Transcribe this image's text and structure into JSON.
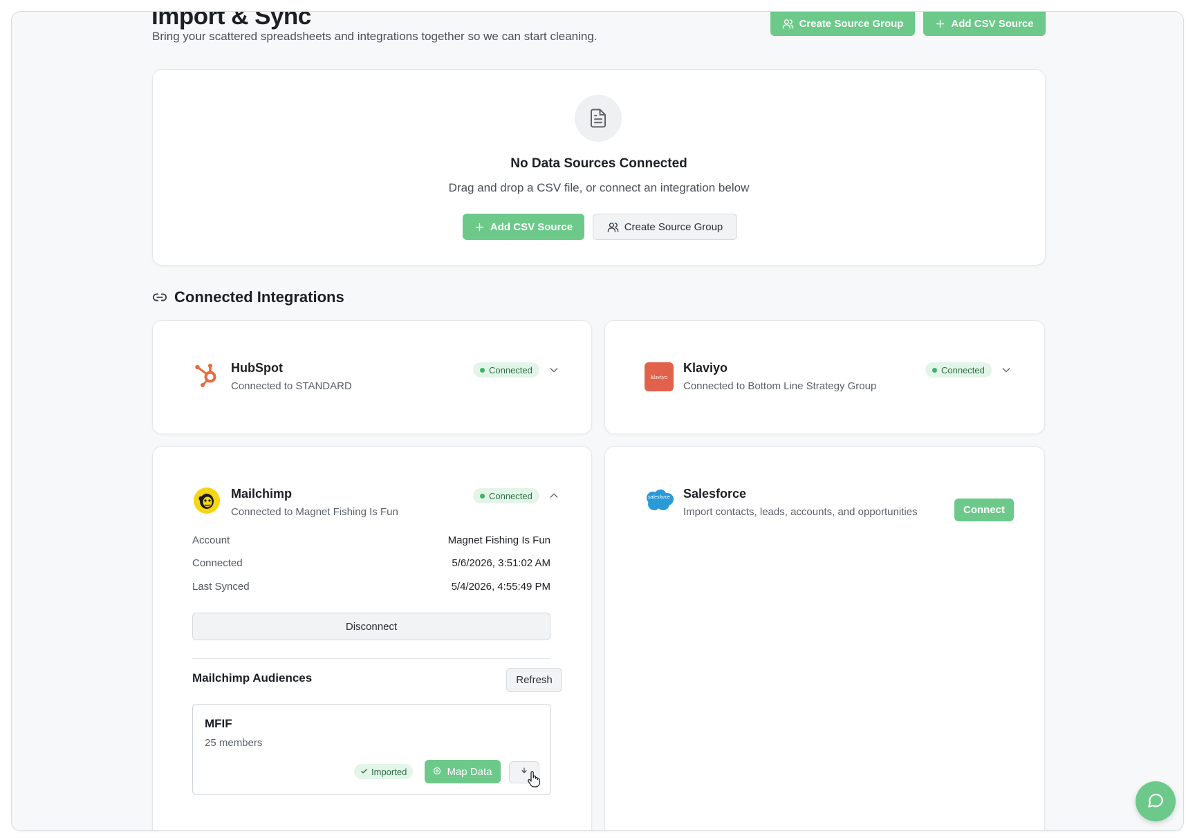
{
  "header": {
    "title": "Import & Sync",
    "subtitle": "Bring your scattered spreadsheets and integrations together so we can start cleaning.",
    "create_group_label": "Create Source Group",
    "add_csv_label": "Add CSV Source"
  },
  "empty_state": {
    "icon": "document-icon",
    "title": "No Data Sources Connected",
    "description": "Drag and drop a CSV file, or connect an integration below",
    "add_csv_label": "Add CSV Source",
    "create_group_label": "Create Source Group"
  },
  "integrations_section": {
    "icon": "link-icon",
    "title": "Connected Integrations"
  },
  "integrations": {
    "hubspot": {
      "name": "HubSpot",
      "subtitle": "Connected to STANDARD",
      "status": "Connected"
    },
    "klaviyo": {
      "name": "Klaviyo",
      "logo_text": "klaviyo",
      "subtitle": "Connected to Bottom Line Strategy Group",
      "status": "Connected"
    },
    "mailchimp": {
      "name": "Mailchimp",
      "subtitle": "Connected to Magnet Fishing Is Fun",
      "status": "Connected",
      "details": [
        {
          "label": "Account",
          "value": "Magnet Fishing Is Fun"
        },
        {
          "label": "Connected",
          "value": "5/6/2026, 3:51:02 AM"
        },
        {
          "label": "Last Synced",
          "value": "5/4/2026, 4:55:49 PM"
        }
      ],
      "disconnect_label": "Disconnect",
      "audiences_title": "Mailchimp Audiences",
      "refresh_label": "Refresh",
      "audience": {
        "name": "MFIF",
        "members": "25 members",
        "imported_label": "Imported",
        "map_label": "Map Data"
      }
    },
    "salesforce": {
      "name": "Salesforce",
      "logo_text": "salesforce",
      "subtitle": "Import contacts, leads, accounts, and opportunities",
      "connect_label": "Connect"
    }
  },
  "colors": {
    "accent_green": "#6cc98a",
    "badge_bg": "#e3f5e9",
    "hubspot_orange": "#ea6a3e",
    "klaviyo_red": "#e2614a",
    "salesforce_blue": "#2a9ad6",
    "mailchimp_yellow": "#f5d516"
  }
}
